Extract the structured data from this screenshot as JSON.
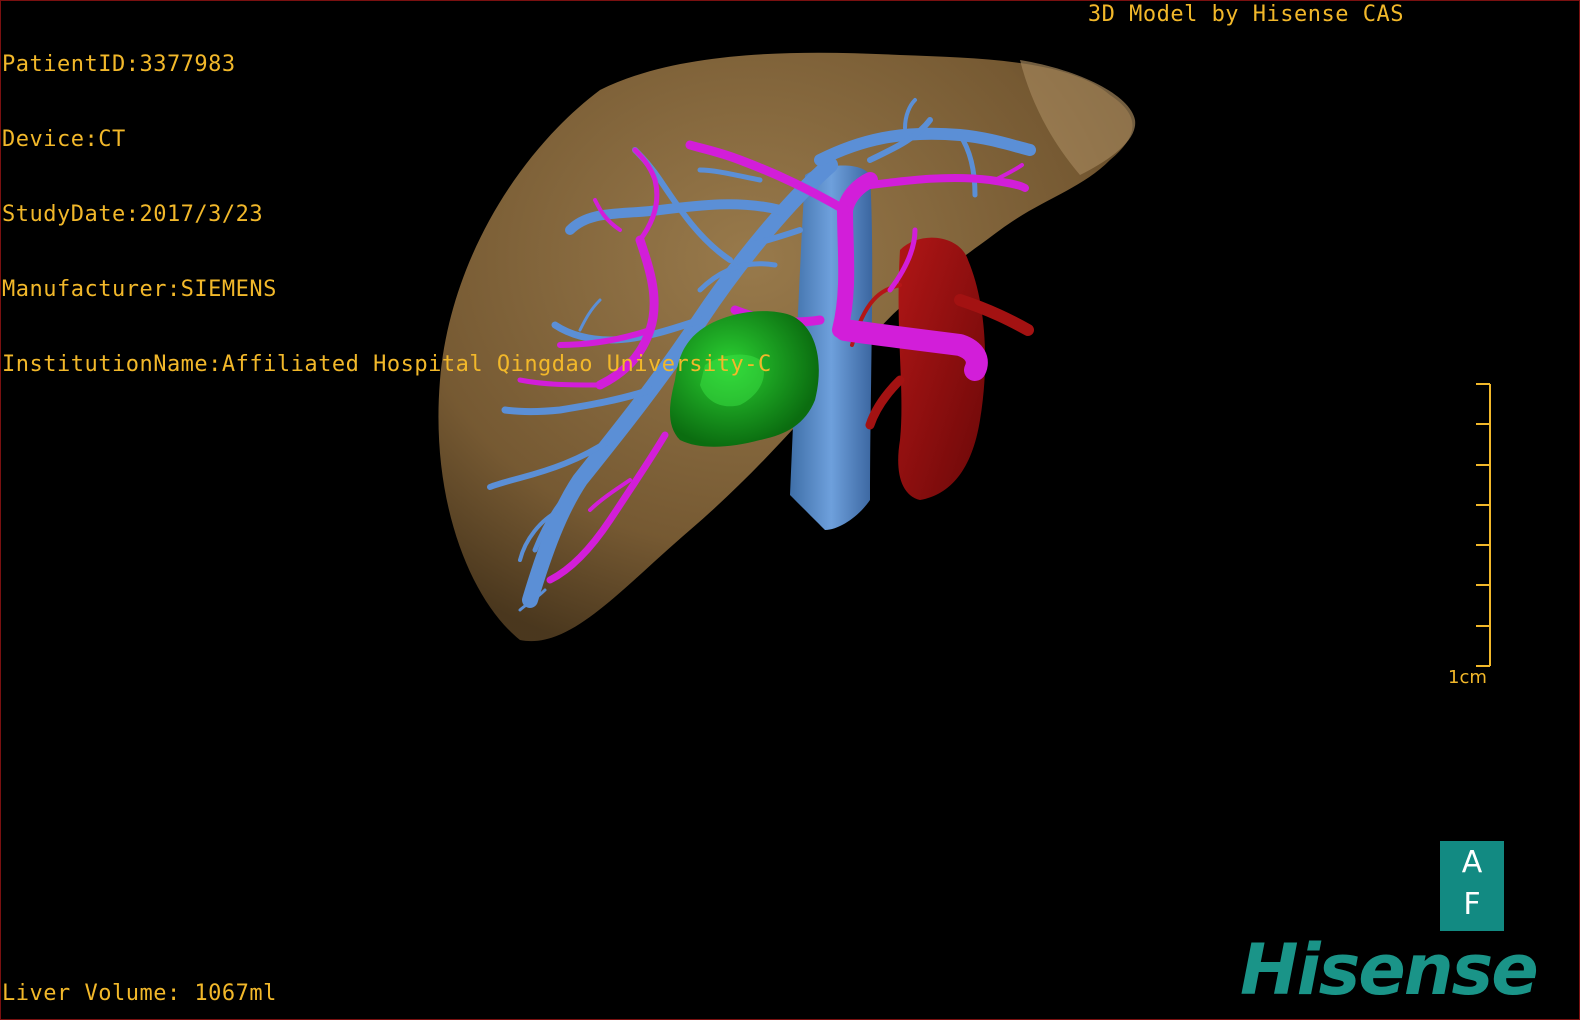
{
  "header": {
    "patient_id": "PatientID:3377983",
    "device": "Device:CT",
    "study_date": "StudyDate:2017/3/23",
    "manufacturer": "Manufacturer:SIEMENS",
    "institution": "InstitutionName:Affiliated Hospital Qingdao University-C",
    "credit": "3D Model by Hisense CAS"
  },
  "footer": {
    "liver_volume": "Liver Volume: 1067ml"
  },
  "scale": {
    "label": "1cm"
  },
  "orientation": {
    "top_label": "A",
    "bottom_label": "F"
  },
  "branding": {
    "logo_text": "Hisense"
  },
  "colors": {
    "overlay_text": "#f2b82a",
    "liver": "#8a6a3e",
    "hepatic_vein": "#5b8fd6",
    "portal_vein": "#d21ed9",
    "tumor": "#15a31a",
    "artery": "#9a0d0d",
    "brand": "#1a9488"
  }
}
